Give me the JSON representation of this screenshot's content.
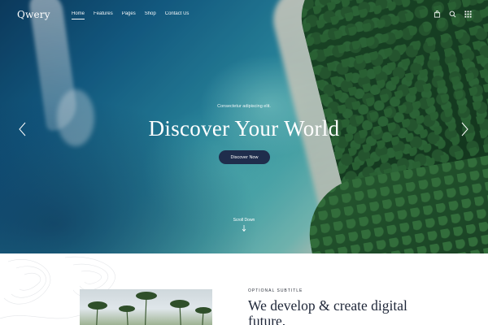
{
  "brand": {
    "logo": "Qwery"
  },
  "nav": {
    "items": [
      {
        "label": "Home",
        "active": true
      },
      {
        "label": "Features",
        "active": false
      },
      {
        "label": "Pages",
        "active": false
      },
      {
        "label": "Shop",
        "active": false
      },
      {
        "label": "Contact Us",
        "active": false
      }
    ],
    "icons": [
      "bag-icon",
      "search-icon",
      "grid-menu-icon"
    ]
  },
  "hero": {
    "eyebrow": "Consectetur adipiscing elit.",
    "title": "Discover Your World",
    "cta_label": "Discover Now",
    "scroll_label": "Scroll Down",
    "prev_icon": "chevron-left-icon",
    "next_icon": "chevron-right-icon"
  },
  "about": {
    "subtitle": "OPTIONAL SUBTITLE",
    "heading": "We develop & create digital future."
  },
  "colors": {
    "button_bg": "#1f2d4c",
    "heading_text": "#1e2638",
    "hero_text": "#ffffff"
  }
}
